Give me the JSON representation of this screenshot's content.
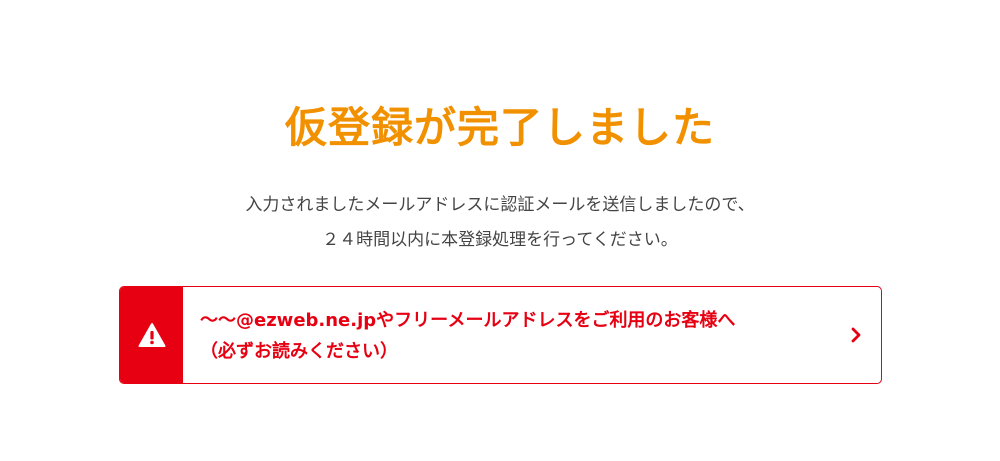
{
  "title": "仮登録が完了しました",
  "description": {
    "line1": "入力されましたメールアドレスに認証メールを送信しましたので、",
    "line2": "２４時間以内に本登録処理を行ってください。"
  },
  "notice": {
    "line1": "～～@ezweb.ne.jpやフリーメールアドレスをご利用のお客様へ",
    "line2": "（必ずお読みください）",
    "icon": "warning-icon",
    "arrow_icon": "chevron-right-icon",
    "color": "#e60012"
  },
  "colors": {
    "title": "#f29100",
    "text": "#444444",
    "alert": "#e60012"
  }
}
